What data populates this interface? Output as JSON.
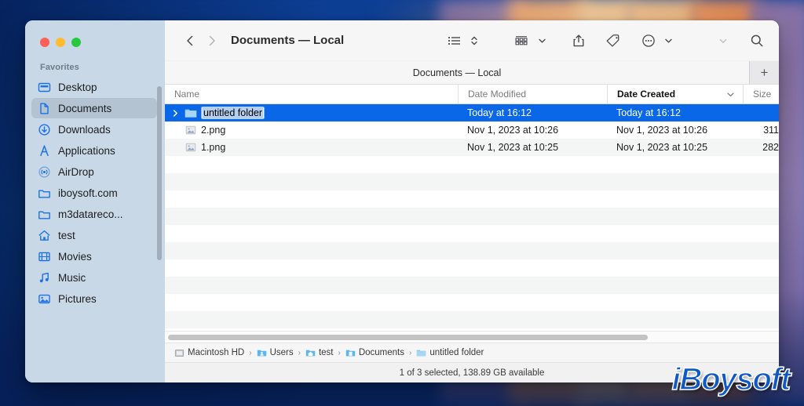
{
  "window": {
    "title": "Documents — Local",
    "traffic_lights": [
      {
        "name": "close",
        "color": "#ff5f57"
      },
      {
        "name": "minimize",
        "color": "#febc2e"
      },
      {
        "name": "maximize",
        "color": "#28c840"
      }
    ]
  },
  "sidebar": {
    "section_title": "Favorites",
    "items": [
      {
        "label": "Desktop",
        "icon": "desktop-icon",
        "active": false
      },
      {
        "label": "Documents",
        "icon": "document-icon",
        "active": true
      },
      {
        "label": "Downloads",
        "icon": "downloads-icon",
        "active": false
      },
      {
        "label": "Applications",
        "icon": "applications-icon",
        "active": false
      },
      {
        "label": "AirDrop",
        "icon": "airdrop-icon",
        "active": false
      },
      {
        "label": "iboysoft.com",
        "icon": "folder-icon",
        "active": false
      },
      {
        "label": "m3datareco...",
        "icon": "folder-icon",
        "active": false
      },
      {
        "label": "test",
        "icon": "home-icon",
        "active": false
      },
      {
        "label": "Movies",
        "icon": "movies-icon",
        "active": false
      },
      {
        "label": "Music",
        "icon": "music-icon",
        "active": false
      },
      {
        "label": "Pictures",
        "icon": "pictures-icon",
        "active": false
      }
    ]
  },
  "toolbar": {
    "back": "back-chevron-icon",
    "forward": "forward-chevron-icon",
    "view_list": "list-view-icon",
    "view_sort": "sort-chevron-icon",
    "group": "group-by-icon",
    "share": "share-icon",
    "tag": "tag-icon",
    "more": "more-actions-icon",
    "collapse": "collapse-chevron-icon",
    "search": "search-icon"
  },
  "tabbar": {
    "active_tab": "Documents — Local",
    "add_label": "+"
  },
  "columns": [
    {
      "key": "name",
      "label": "Name",
      "sorted": false
    },
    {
      "key": "mod",
      "label": "Date Modified",
      "sorted": false
    },
    {
      "key": "crt",
      "label": "Date Created",
      "sorted": true
    },
    {
      "key": "size",
      "label": "Size",
      "sorted": false
    }
  ],
  "files": [
    {
      "name": "untitled folder",
      "icon": "folder-icon",
      "date_modified": "Today at 16:12",
      "date_created": "Today at 16:12",
      "size": "",
      "selected": true,
      "renaming": true,
      "has_disclosure": true
    },
    {
      "name": "2.png",
      "icon": "png-file-icon",
      "date_modified": "Nov 1, 2023 at 10:26",
      "date_created": "Nov 1, 2023 at 10:26",
      "size": "311",
      "selected": false,
      "renaming": false,
      "has_disclosure": false
    },
    {
      "name": "1.png",
      "icon": "png-file-icon",
      "date_modified": "Nov 1, 2023 at 10:25",
      "date_created": "Nov 1, 2023 at 10:25",
      "size": "282",
      "selected": false,
      "renaming": false,
      "has_disclosure": false
    }
  ],
  "pathbar": [
    {
      "label": "Macintosh HD",
      "icon": "harddisk-icon"
    },
    {
      "label": "Users",
      "icon": "users-folder-icon"
    },
    {
      "label": "test",
      "icon": "home-folder-icon"
    },
    {
      "label": "Documents",
      "icon": "documents-folder-icon"
    },
    {
      "label": "untitled folder",
      "icon": "folder-icon"
    }
  ],
  "statusbar": {
    "text": "1 of 3 selected, 138.89 GB available"
  },
  "watermark": {
    "text": "iBoysoft",
    "color": "#1059c4"
  },
  "colors": {
    "selection_blue": "#0a68e8",
    "sidebar_bg": "#c9d8e6",
    "toolbar_bg": "#f6f6f7",
    "row_alt": "#f4f5f5",
    "sidebar_icon_blue": "#1b72e8"
  }
}
